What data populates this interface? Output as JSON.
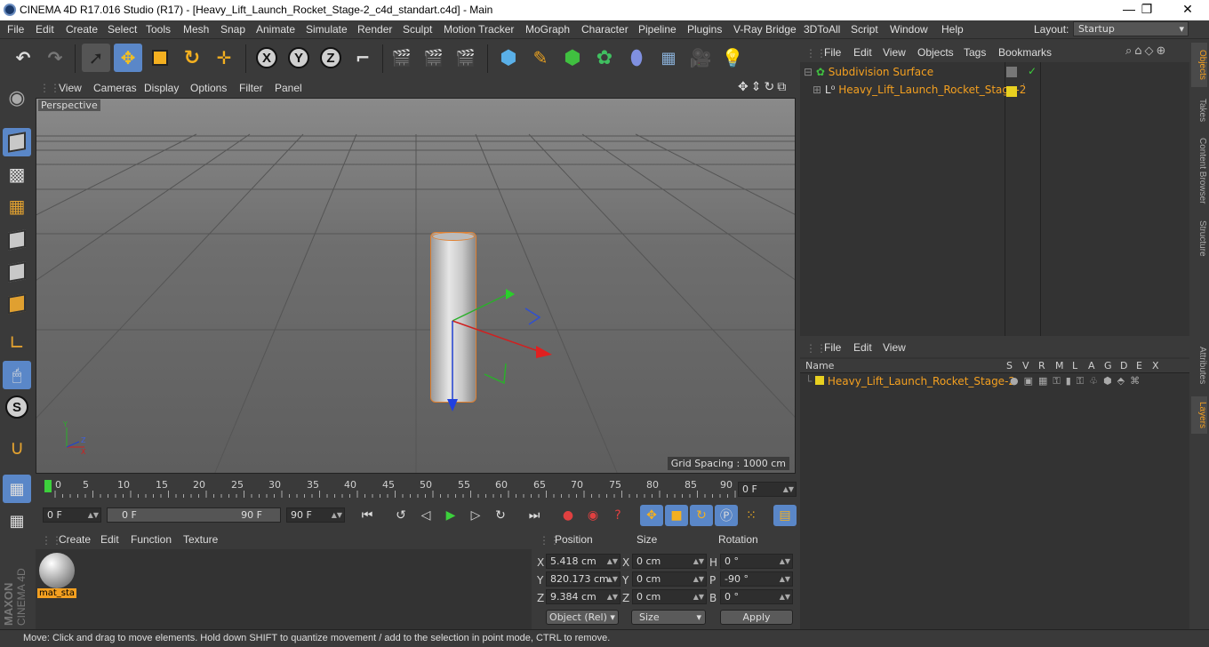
{
  "window": {
    "title": "CINEMA 4D R17.016 Studio (R17) - [Heavy_Lift_Launch_Rocket_Stage-2_c4d_standart.c4d] - Main",
    "min": "—",
    "max": "❐",
    "close": "✕"
  },
  "menu": [
    "File",
    "Edit",
    "Create",
    "Select",
    "Tools",
    "Mesh",
    "Snap",
    "Animate",
    "Simulate",
    "Render",
    "Sculpt",
    "Motion Tracker",
    "MoGraph",
    "Character",
    "Pipeline",
    "Plugins",
    "V-Ray Bridge",
    "3DToAll",
    "Script",
    "Window",
    "Help"
  ],
  "layout": {
    "label": "Layout:",
    "value": "Startup"
  },
  "toolbar": {
    "x": "X",
    "y": "Y",
    "z": "Z"
  },
  "viewport": {
    "menu": [
      "View",
      "Cameras",
      "Display",
      "Options",
      "Filter",
      "Panel"
    ],
    "label": "Perspective",
    "grid_spacing": "Grid Spacing : 1000 cm"
  },
  "timeline": {
    "ticks": [
      "0",
      "5",
      "10",
      "15",
      "20",
      "25",
      "30",
      "35",
      "40",
      "45",
      "50",
      "55",
      "60",
      "65",
      "70",
      "75",
      "80",
      "85",
      "90"
    ],
    "frame_field": "0 F"
  },
  "transport": {
    "start": "0 F",
    "range_start": "0 F",
    "range_end": "90 F",
    "end": "90 F"
  },
  "materials": {
    "menu": [
      "Create",
      "Edit",
      "Function",
      "Texture"
    ],
    "item": "mat_sta"
  },
  "coords": {
    "headers": [
      "Position",
      "Size",
      "Rotation"
    ],
    "rows": [
      {
        "axis": "X",
        "pos": "5.418 cm",
        "saxis": "X",
        "size": "0 cm",
        "raxis": "H",
        "rot": "0 °"
      },
      {
        "axis": "Y",
        "pos": "820.173 cm",
        "saxis": "Y",
        "size": "0 cm",
        "raxis": "P",
        "rot": "-90 °"
      },
      {
        "axis": "Z",
        "pos": "9.384 cm",
        "saxis": "Z",
        "size": "0 cm",
        "raxis": "B",
        "rot": "0 °"
      }
    ],
    "mode": "Object (Rel)",
    "size_mode": "Size",
    "apply": "Apply"
  },
  "objects": {
    "menu": [
      "File",
      "Edit",
      "View",
      "Objects",
      "Tags",
      "Bookmarks"
    ],
    "items": [
      "Subdivision Surface",
      "Heavy_Lift_Launch_Rocket_Stage-2"
    ]
  },
  "layers": {
    "menu": [
      "File",
      "Edit",
      "View"
    ],
    "cols": [
      "Name",
      "S",
      "V",
      "R",
      "M",
      "L",
      "A",
      "G",
      "D",
      "E",
      "X"
    ],
    "item": "Heavy_Lift_Launch_Rocket_Stage-2"
  },
  "side_tabs": [
    "Objects",
    "Takes",
    "Content Browser",
    "Structure",
    "Attributes",
    "Layers"
  ],
  "brand": [
    "MAXON",
    "CINEMA 4D"
  ],
  "status": "Move: Click and drag to move elements. Hold down SHIFT to quantize movement / add to the selection in point mode, CTRL to remove.",
  "colors": {
    "accent": "#5a87c8",
    "orange": "#f4a020",
    "layer": "#e8d020"
  }
}
